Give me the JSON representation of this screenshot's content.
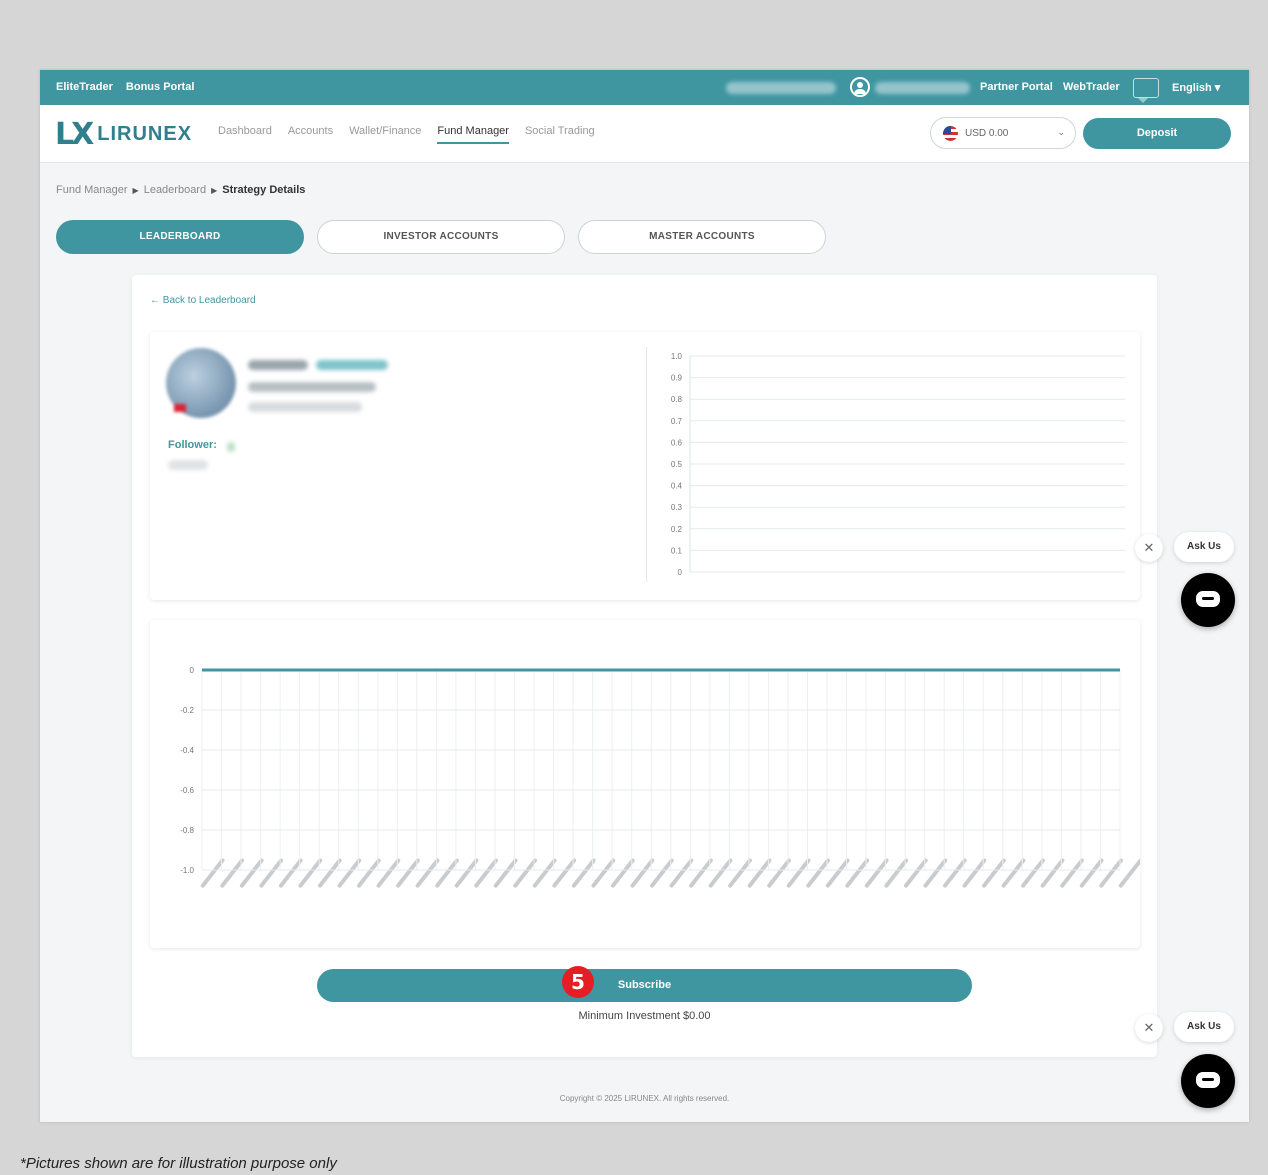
{
  "topbar": {
    "left_links": [
      "EliteTrader",
      "Bonus Portal"
    ],
    "partner_portal": "Partner Portal",
    "webtrader": "WebTrader",
    "language": "English ▾"
  },
  "nav": {
    "logo_mark": "LX",
    "logo_text": "LIRUNEX",
    "items": [
      "Dashboard",
      "Accounts",
      "Wallet/Finance",
      "Fund Manager",
      "Social Trading"
    ],
    "active_item": "Fund Manager",
    "currency": "USD 0.00",
    "deposit_label": "Deposit"
  },
  "breadcrumb": {
    "items": [
      "Fund Manager",
      "Leaderboard"
    ],
    "current": "Strategy Details"
  },
  "tabs": [
    "LEADERBOARD",
    "INVESTOR ACCOUNTS",
    "MASTER ACCOUNTS"
  ],
  "active_tab": "LEADERBOARD",
  "card": {
    "back_link": "← Back to Leaderboard",
    "follower_label": "Follower:",
    "subscribe_label": "Subscribe",
    "step_number": "5",
    "min_investment": "Minimum Investment $0.00"
  },
  "footer": {
    "copyright": "Copyright © 2025 LIRUNEX. All rights reserved."
  },
  "ask_us": {
    "label": "Ask Us",
    "close": "✕"
  },
  "disclaimer": "*Pictures shown are for illustration purpose only",
  "colors": {
    "brand": "#3f96a1",
    "badge": "#e51d25",
    "chat": "#000000"
  },
  "chart_data": [
    {
      "type": "line",
      "y_ticks": [
        "1.0",
        "0.9",
        "0.8",
        "0.7",
        "0.6",
        "0.5",
        "0.4",
        "0.3",
        "0.2",
        "0.1",
        "0"
      ],
      "ylim": [
        0,
        1.0
      ],
      "grid": true,
      "series": []
    },
    {
      "type": "line",
      "y_ticks": [
        "0",
        "-0.2",
        "-0.4",
        "-0.6",
        "-0.8",
        "-1.0"
      ],
      "ylim": [
        -1.0,
        0
      ],
      "grid": true,
      "x_count": 48,
      "series": [
        {
          "values_constant": 0
        }
      ]
    }
  ]
}
